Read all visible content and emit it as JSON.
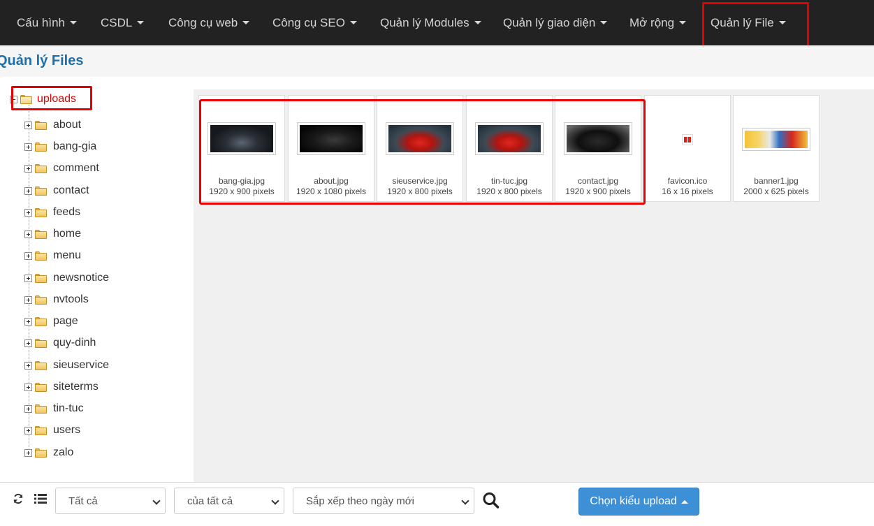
{
  "nav": {
    "items": [
      {
        "label": "Cấu hình"
      },
      {
        "label": "CSDL"
      },
      {
        "label": "Công cụ web"
      },
      {
        "label": "Công cụ SEO"
      },
      {
        "label": "Quản lý Modules"
      },
      {
        "label": "Quản lý giao diện"
      },
      {
        "label": "Mở rộng"
      },
      {
        "label": "Quản lý File"
      }
    ]
  },
  "page": {
    "title": "Quản lý Files"
  },
  "tree": {
    "root": "uploads",
    "folders": [
      "about",
      "bang-gia",
      "comment",
      "contact",
      "feeds",
      "home",
      "menu",
      "newsnotice",
      "nvtools",
      "page",
      "quy-dinh",
      "sieuservice",
      "siteterms",
      "tin-tuc",
      "users",
      "zalo"
    ]
  },
  "files": [
    {
      "name": "bang-gia.jpg",
      "size": "1920 x 900 pixels"
    },
    {
      "name": "about.jpg",
      "size": "1920 x 1080 pixels"
    },
    {
      "name": "sieuservice.jpg",
      "size": "1920 x 800 pixels"
    },
    {
      "name": "tin-tuc.jpg",
      "size": "1920 x 800 pixels"
    },
    {
      "name": "contact.jpg",
      "size": "1920 x 900 pixels"
    },
    {
      "name": "favicon.ico",
      "size": "16 x 16 pixels"
    },
    {
      "name": "banner1.jpg",
      "size": "2000 x 625 pixels"
    }
  ],
  "toolbar": {
    "filter_type": "Tất cả",
    "filter_owner": "của tất cả",
    "sort": "Sắp xếp theo ngày mới",
    "upload_label": "Chọn kiểu upload",
    "icons": [
      "refresh-icon",
      "list-icon",
      "search-icon"
    ]
  },
  "colors": {
    "navbar_bg": "#222222",
    "title_color": "#1f6fa8",
    "highlight": "#e60000",
    "upload_button": "#3d8fd6"
  }
}
